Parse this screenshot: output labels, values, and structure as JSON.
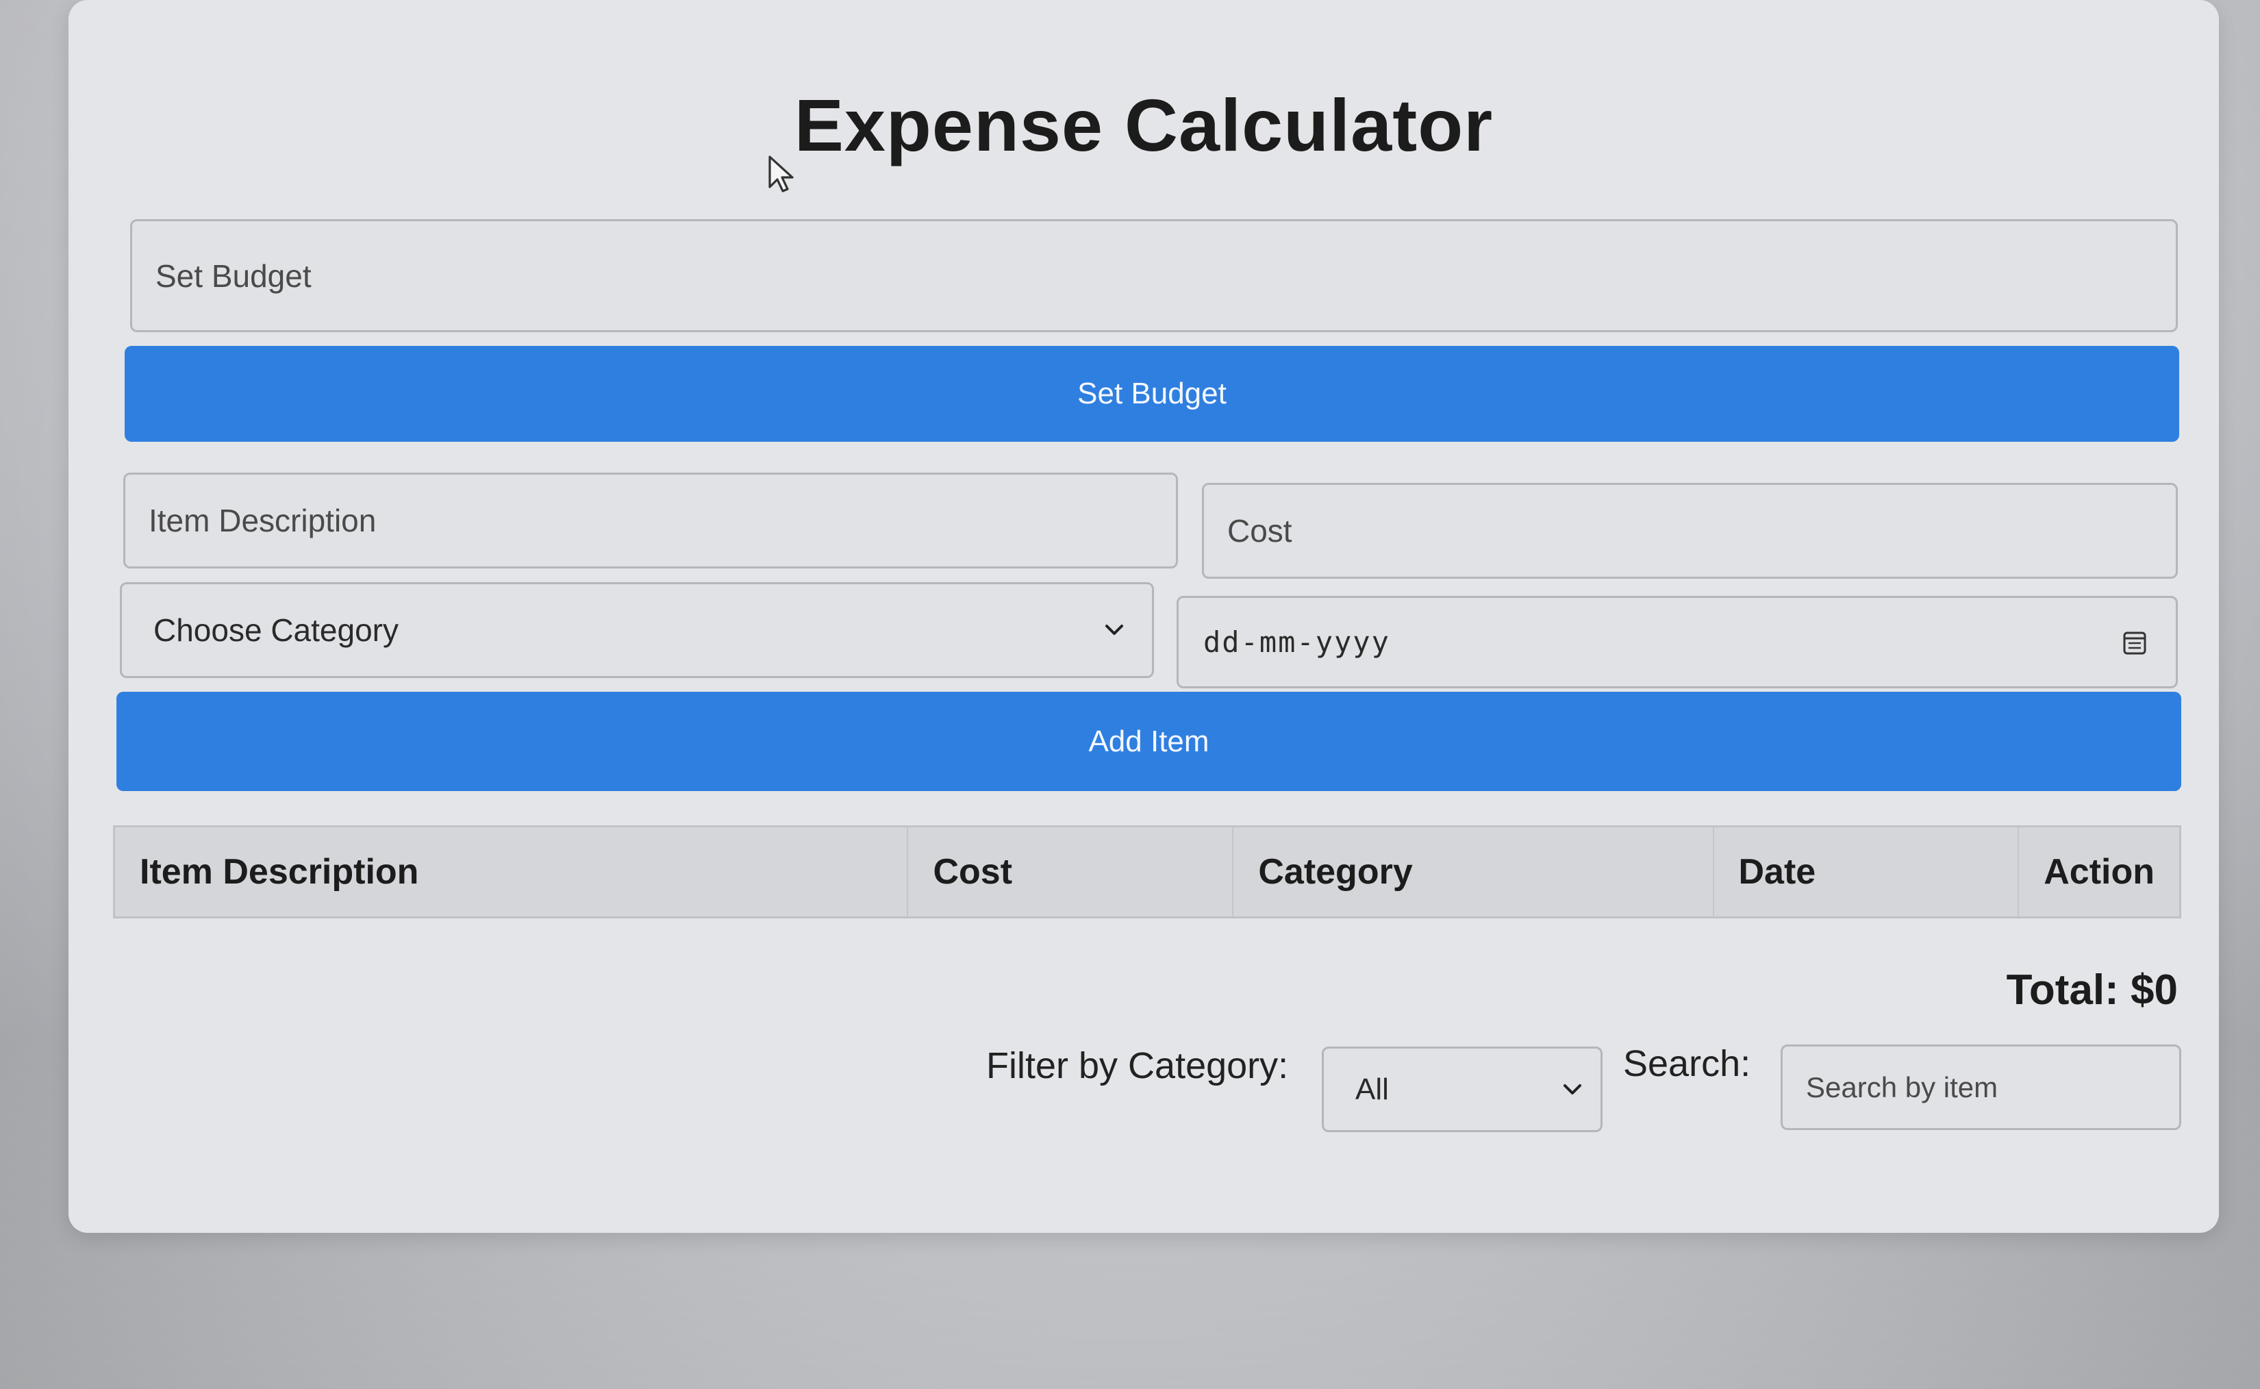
{
  "title": "Expense Calculator",
  "budget": {
    "input_placeholder": "Set Budget",
    "button_label": "Set Budget"
  },
  "item_form": {
    "description_placeholder": "Item Description",
    "cost_placeholder": "Cost",
    "category_select": "Choose Category",
    "date_placeholder": "dd-mm-yyyy",
    "add_button_label": "Add Item"
  },
  "table": {
    "columns": [
      "Item Description",
      "Cost",
      "Category",
      "Date",
      "Action"
    ]
  },
  "total": {
    "label": "Total: $0"
  },
  "filter": {
    "label": "Filter by Category:",
    "selected": "All"
  },
  "search": {
    "label": "Search:",
    "placeholder": "Search by item"
  },
  "icons": {
    "cursor": "mouse-pointer-icon",
    "category_dropdown": "chevron-down-icon",
    "date_picker": "calendar-icon",
    "filter_dropdown": "chevron-down-icon"
  },
  "colors": {
    "primary_button": "#2f7fe0",
    "card_background": "#e4e5e8"
  }
}
